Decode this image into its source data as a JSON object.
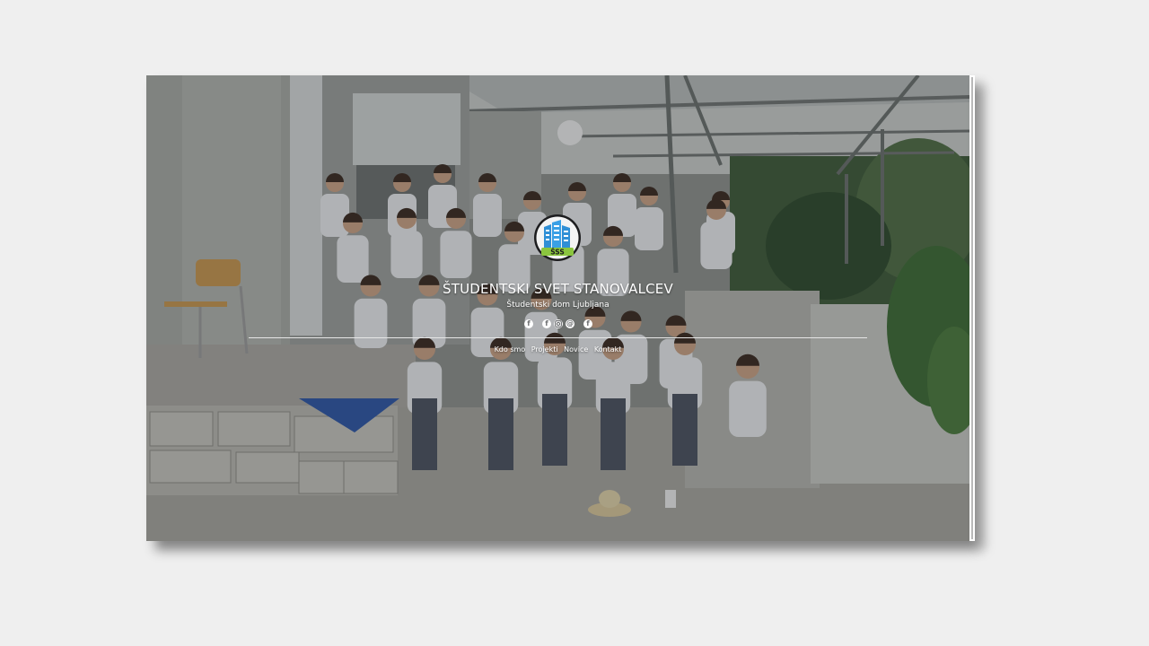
{
  "hero": {
    "title": "ŠTUDENTSKI SVET STANOVALCEV",
    "subtitle": "Študentski dom Ljubljana",
    "logo_text": "ŠSS"
  },
  "socials": [
    {
      "icon": "facebook-icon",
      "glyph": "f"
    },
    {
      "icon": "facebook-icon",
      "glyph": "f"
    },
    {
      "icon": "instagram-icon",
      "glyph": ""
    },
    {
      "icon": "email-icon",
      "glyph": "@"
    },
    {
      "icon": "facebook-icon",
      "glyph": "f"
    }
  ],
  "nav": {
    "items": [
      "Kdo smo",
      "Projekti",
      "Novice",
      "Kontakt"
    ]
  },
  "colors": {
    "page_background": "#efefef",
    "overlay_text": "#ffffff",
    "logo_blue": "#2f8fd6",
    "logo_green": "#8bc53f"
  }
}
